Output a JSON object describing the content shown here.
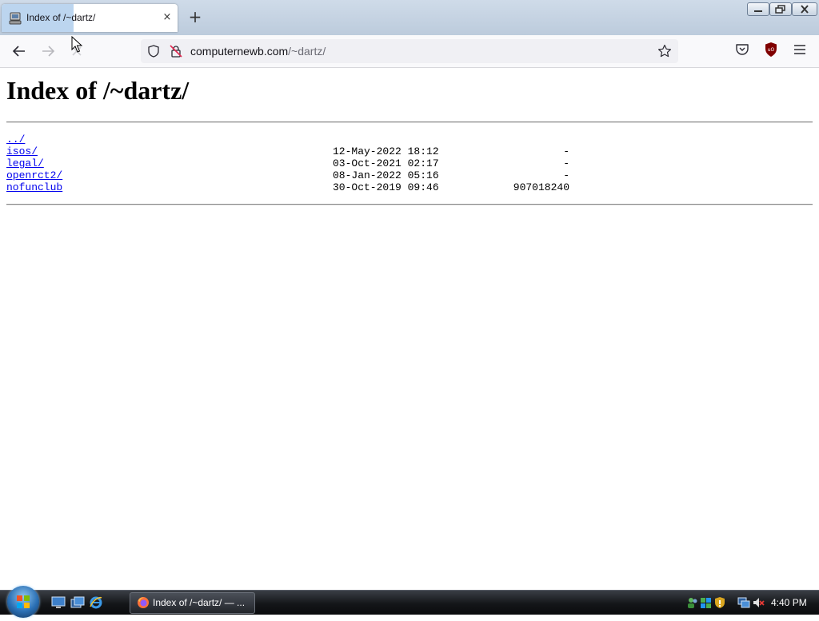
{
  "browser": {
    "tab": {
      "title": "Index of /~dartz/",
      "close_symbol": "×"
    },
    "new_tab_symbol": "+",
    "url": {
      "host": "computernewb.com",
      "path": "/~dartz/"
    }
  },
  "page": {
    "heading": "Index of /~dartz/",
    "entries": [
      {
        "name": "../",
        "date": "",
        "size": ""
      },
      {
        "name": "isos/",
        "date": "12-May-2022 18:12",
        "size": "-"
      },
      {
        "name": "legal/",
        "date": "03-Oct-2021 02:17",
        "size": "-"
      },
      {
        "name": "openrct2/",
        "date": "08-Jan-2022 05:16",
        "size": "-"
      },
      {
        "name": "nofunclub",
        "date": "30-Oct-2019 09:46",
        "size": "907018240"
      }
    ]
  },
  "taskbar": {
    "task_label": "Index of /~dartz/ — ...",
    "clock": "4:40 PM"
  },
  "icons": [
    "tab-favicon-icon",
    "close-icon",
    "plus-icon",
    "back-arrow-icon",
    "forward-arrow-icon",
    "stop-icon",
    "shield-icon",
    "insecure-lock-icon",
    "star-icon",
    "pocket-icon",
    "ublock-icon",
    "hamburger-menu-icon",
    "windows-start-icon",
    "show-desktop-icon",
    "switch-windows-icon",
    "internet-explorer-icon",
    "firefox-icon",
    "network-icon",
    "volume-muted-icon"
  ],
  "colors": {
    "link": "#0000ee",
    "taskbar": "#141619",
    "tabstrip": "#cfdbe9",
    "ublock_red": "#800000"
  }
}
